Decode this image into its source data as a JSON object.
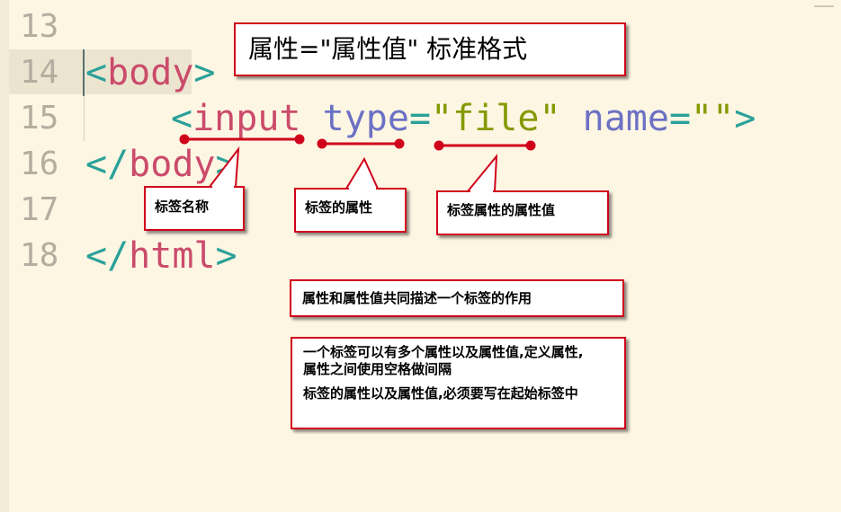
{
  "editor": {
    "line_numbers": [
      "13",
      "14",
      "15",
      "16",
      "17",
      "18"
    ],
    "line14": {
      "open": "<",
      "tag": "body",
      "close": ">"
    },
    "line15": {
      "open": "<",
      "tag": "input",
      "attr1": "type",
      "eq1": "=",
      "val1": "\"file\"",
      "attr2": "name",
      "eq2": "=",
      "val2": "\"\"",
      "close": ">"
    },
    "line16": {
      "open": "</",
      "tag": "body",
      "close": ">"
    },
    "line18": {
      "open": "</",
      "tag": "html",
      "close": ">"
    },
    "colors": {
      "background": "#fdf6e3",
      "punct": "#2aa198",
      "tag": "#cb4b6b",
      "attr": "#6c71c4",
      "string": "#859900",
      "annotation": "#d0021b"
    }
  },
  "annotations": {
    "title": "属性=\"属性值\" 标准格式",
    "tag_name": "标签名称",
    "tag_attr": "标签的属性",
    "attr_value": "标签属性的属性值",
    "describe": "属性和属性值共同描述一个标签的作用",
    "multi_line1": "一个标签可以有多个属性以及属性值,定义属性,",
    "multi_line2": "属性之间使用空格做间隔",
    "multi_line3": "标签的属性以及属性值,必须要写在起始标签中"
  }
}
